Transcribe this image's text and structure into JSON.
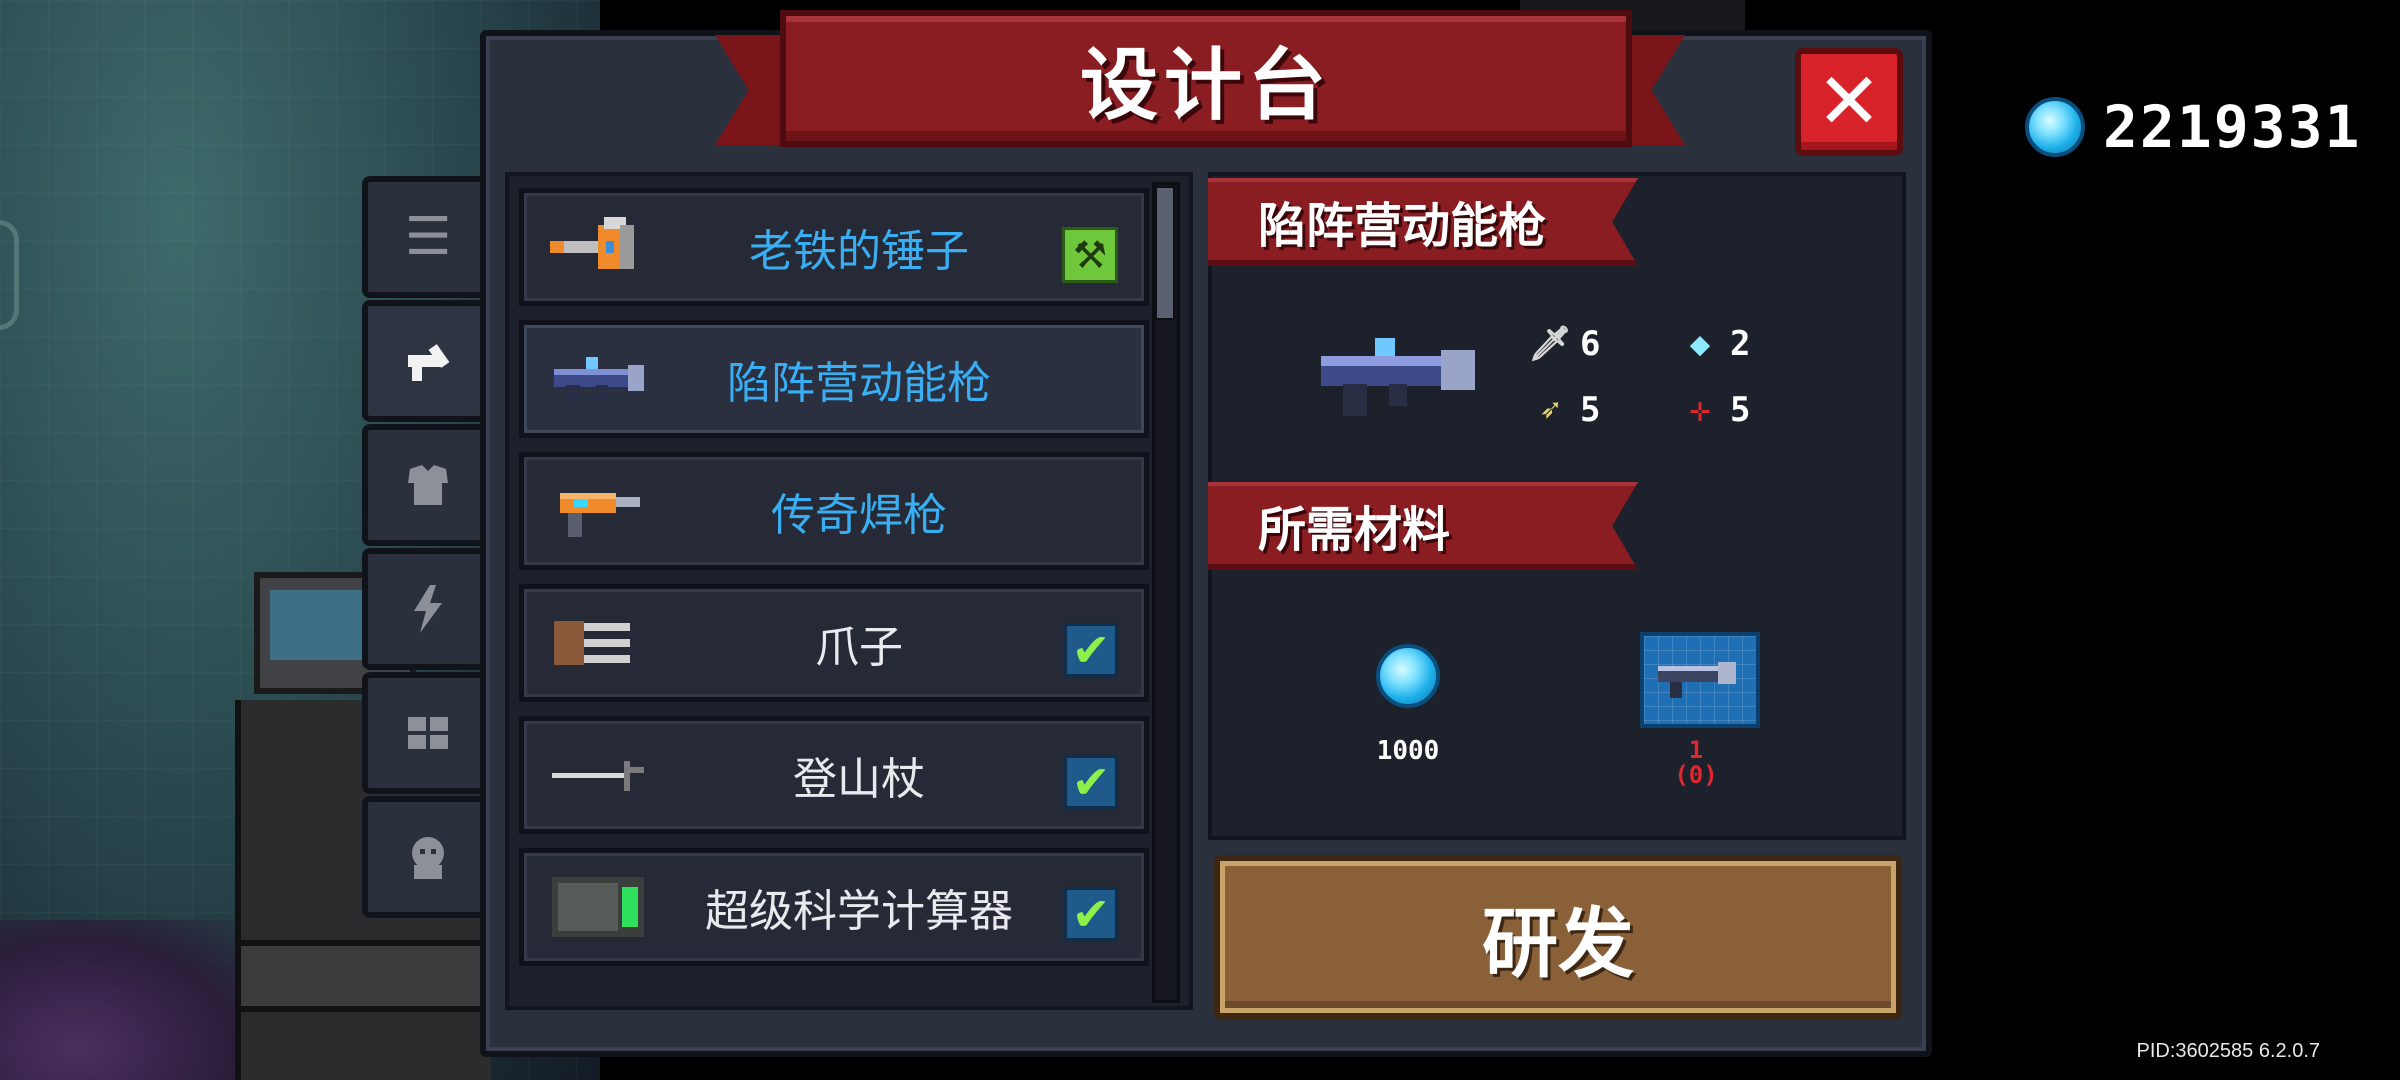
{
  "title": "设计台",
  "currency": {
    "icon": "blue-gem-icon",
    "value": "2219331"
  },
  "side_tabs": [
    {
      "icon": "list-icon"
    },
    {
      "icon": "weapon-icon"
    },
    {
      "icon": "armor-icon"
    },
    {
      "icon": "lightning-icon"
    },
    {
      "icon": "skill-icon"
    },
    {
      "icon": "pet-icon"
    }
  ],
  "items": [
    {
      "label": "老铁的锤子",
      "status": "pickaxe"
    },
    {
      "label": "陷阵营动能枪",
      "status": "none"
    },
    {
      "label": "传奇焊枪",
      "status": "none"
    },
    {
      "label": "爪子",
      "status": "check"
    },
    {
      "label": "登山杖",
      "status": "check"
    },
    {
      "label": "超级科学计算器",
      "status": "check"
    }
  ],
  "detail": {
    "name": "陷阵营动能枪",
    "stats": {
      "damage": "6",
      "energy": "2",
      "critical": "5",
      "accuracy": "5"
    },
    "materials_title": "所需材料",
    "materials": [
      {
        "name": "blue-gem",
        "count": "1000"
      },
      {
        "name": "blueprint",
        "count": "1",
        "owned": "(0)"
      }
    ],
    "research_button": "研发"
  },
  "pid": "PID:3602585 6.2.0.7",
  "colors": {
    "banner": "#8a1d22",
    "panel": "#2b303d",
    "item_highlight": "#3aaef2",
    "research": "#8a6039"
  }
}
